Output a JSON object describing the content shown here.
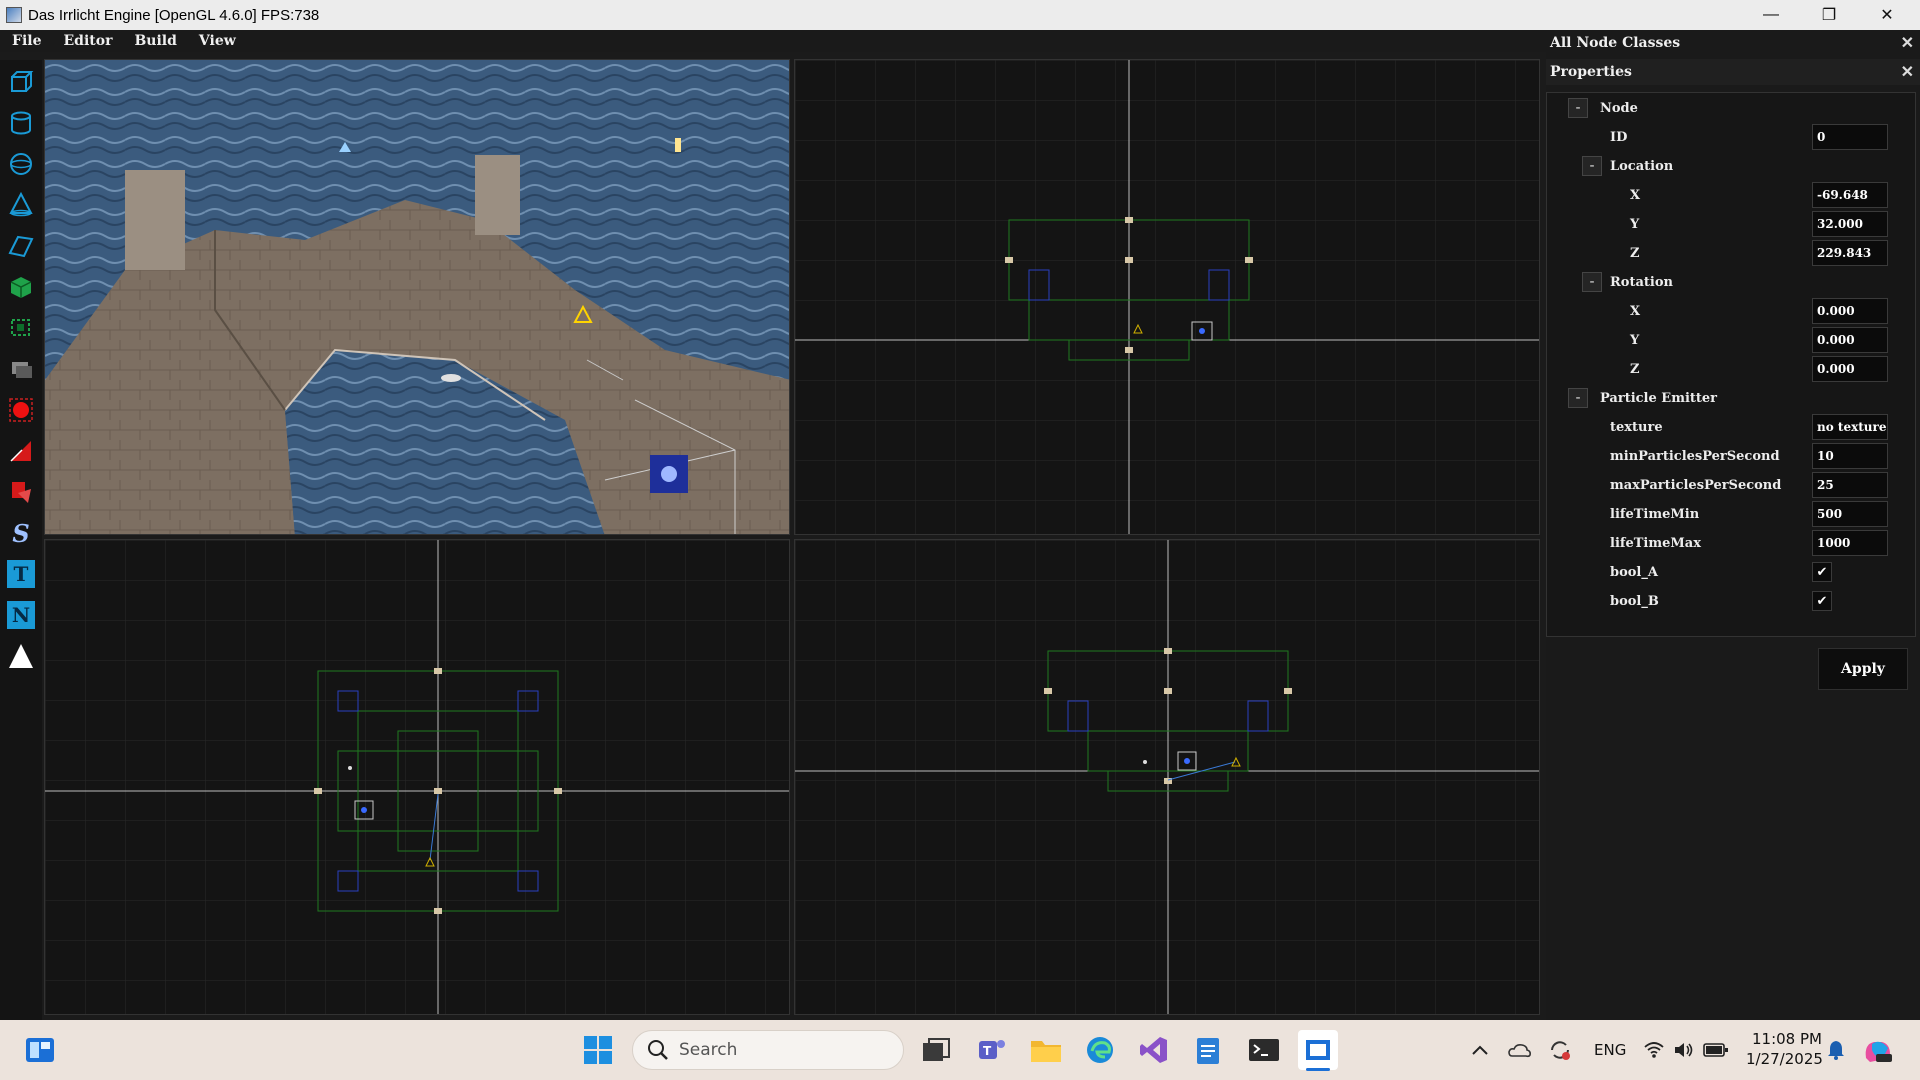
{
  "window": {
    "title": "Das Irrlicht Engine  [OpenGL 4.6.0] FPS:738",
    "minimize": "—",
    "maximize": "❐",
    "close": "✕"
  },
  "menu": [
    "File",
    "Editor",
    "Build",
    "View"
  ],
  "toolbar": {
    "tools": [
      "cube-wire-tool-icon",
      "cylinder-tool-icon",
      "sphere-tool-icon",
      "cone-tool-icon",
      "plane-tool-icon",
      "solid-cube-tool-icon",
      "mesh-tool-icon",
      "light-box-tool-icon",
      "particle-tool-icon",
      "emitter-tool-icon",
      "paint-tool-icon",
      "s-tool-icon",
      "t-tool-icon",
      "n-tool-icon",
      "triangle-tool-icon"
    ],
    "s_label": "S",
    "t_label": "T",
    "n_label": "N"
  },
  "panels": {
    "all_node_classes": "All Node Classes",
    "properties": "Properties",
    "close": "✕"
  },
  "properties": {
    "node_section": "Node",
    "id_label": "ID",
    "id_value": "0",
    "location_section": "Location",
    "loc_x_label": "X",
    "loc_x": "-69.648",
    "loc_y_label": "Y",
    "loc_y": "32.000",
    "loc_z_label": "Z",
    "loc_z": "229.843",
    "rotation_section": "Rotation",
    "rot_x_label": "X",
    "rot_x": "0.000",
    "rot_y_label": "Y",
    "rot_y": "0.000",
    "rot_z_label": "Z",
    "rot_z": "0.000",
    "emitter_section": "Particle Emitter",
    "texture_label": "texture",
    "texture_value": "no texture",
    "min_pps_label": "minParticlesPerSecond",
    "min_pps_value": "10",
    "max_pps_label": "maxParticlesPerSecond",
    "max_pps_value": "25",
    "lifemin_label": "lifeTimeMin",
    "lifemin_value": "500",
    "lifemax_label": "lifeTimeMax",
    "lifemax_value": "1000",
    "bool_a_label": "bool_A",
    "bool_a_checked": true,
    "bool_b_label": "bool_B",
    "bool_b_checked": true,
    "collapse_glyph": "-",
    "check_glyph": "✔",
    "apply_label": "Apply"
  },
  "taskbar": {
    "search_placeholder": "Search",
    "lang": "ENG",
    "time": "11:08 PM",
    "date": "1/27/2025"
  },
  "colors": {
    "grid": "#2a2a2a",
    "axis": "#bdbdbd",
    "wire_green": "#1f7a1f",
    "wire_blue": "#2a3fc0",
    "accent_blue": "#1a9ad6"
  }
}
